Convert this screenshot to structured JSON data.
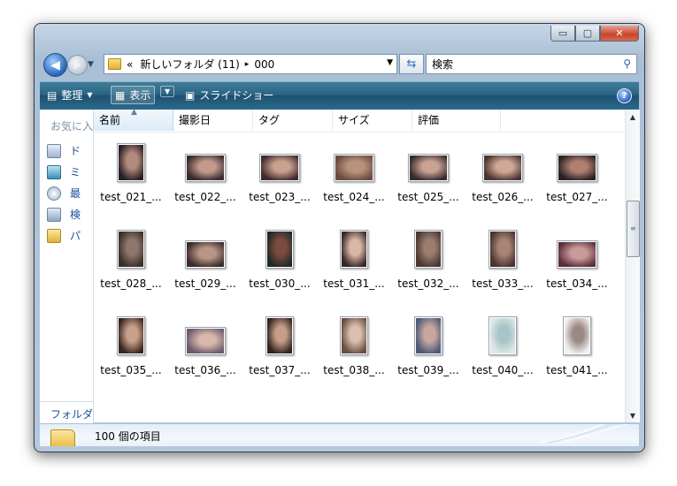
{
  "window": {
    "caption_buttons": {
      "minimize": "▭",
      "maximize": "▢",
      "close": "✕"
    }
  },
  "address_bar": {
    "prefix": "«",
    "breadcrumbs": [
      "新しいフォルダ (11)",
      "000"
    ],
    "separator": "▸"
  },
  "search": {
    "placeholder": "検索"
  },
  "command_bar": {
    "organize": "整理",
    "view": "表示",
    "slideshow": "スライドショー"
  },
  "nav_pane": {
    "favorites_header": "お気に入",
    "items": [
      "ド",
      "ミ",
      "最",
      "検",
      "パ"
    ],
    "folders_label": "フォルダ"
  },
  "columns": [
    "名前",
    "撮影日",
    "タグ",
    "サイズ",
    "評価"
  ],
  "files": [
    {
      "label": "test_021_...",
      "orient": "portrait",
      "colors": [
        "#2a1f24",
        "#b38b7e"
      ]
    },
    {
      "label": "test_022_...",
      "orient": "landscape",
      "colors": [
        "#3a2a2e",
        "#c49a8c"
      ]
    },
    {
      "label": "test_023_...",
      "orient": "landscape",
      "colors": [
        "#402c2c",
        "#caa08f"
      ]
    },
    {
      "label": "test_024_...",
      "orient": "landscape",
      "colors": [
        "#6b4b3f",
        "#b8937c"
      ]
    },
    {
      "label": "test_025_...",
      "orient": "landscape",
      "colors": [
        "#3a2a2e",
        "#c9a293"
      ]
    },
    {
      "label": "test_026_...",
      "orient": "landscape",
      "colors": [
        "#4a3430",
        "#d0a898"
      ]
    },
    {
      "label": "test_027_...",
      "orient": "landscape",
      "colors": [
        "#2d2022",
        "#b08070"
      ]
    },
    {
      "label": "test_028_...",
      "orient": "portrait",
      "colors": [
        "#3b2f2c",
        "#8f766c"
      ]
    },
    {
      "label": "test_029_...",
      "orient": "landscape",
      "colors": [
        "#3c2b2b",
        "#b79685"
      ]
    },
    {
      "label": "test_030_...",
      "orient": "portrait",
      "colors": [
        "#1f2a24",
        "#7d4a3f"
      ]
    },
    {
      "label": "test_031_...",
      "orient": "portrait",
      "colors": [
        "#3a2824",
        "#d9b8a8"
      ]
    },
    {
      "label": "test_032_...",
      "orient": "portrait",
      "colors": [
        "#4a3732",
        "#9c7d70"
      ]
    },
    {
      "label": "test_033_...",
      "orient": "portrait",
      "colors": [
        "#4a3430",
        "#a88474"
      ]
    },
    {
      "label": "test_034_...",
      "orient": "landscape",
      "colors": [
        "#5a2f3a",
        "#c89a9a"
      ]
    },
    {
      "label": "test_035_...",
      "orient": "portrait",
      "colors": [
        "#3a2620",
        "#c9a08a"
      ]
    },
    {
      "label": "test_036_...",
      "orient": "landscape",
      "colors": [
        "#6b5a6a",
        "#d9b7ad"
      ]
    },
    {
      "label": "test_037_...",
      "orient": "portrait",
      "colors": [
        "#2f2420",
        "#c79c88"
      ]
    },
    {
      "label": "test_038_...",
      "orient": "portrait",
      "colors": [
        "#6a4e40",
        "#dcc0ad"
      ]
    },
    {
      "label": "test_039_...",
      "orient": "portrait",
      "colors": [
        "#4c5a78",
        "#c8a7a0"
      ]
    },
    {
      "label": "test_040_...",
      "orient": "portrait",
      "colors": [
        "#dfe8e6",
        "#a8c4c8"
      ]
    },
    {
      "label": "test_041_...",
      "orient": "portrait",
      "colors": [
        "#f1f0ee",
        "#9a8a84"
      ]
    }
  ],
  "details": {
    "count_text": "100 個の項目"
  },
  "colors": {
    "command_bar": "#2b6483",
    "nav_text": "#1c4f9a",
    "window_frame": "#b6c8dc"
  }
}
